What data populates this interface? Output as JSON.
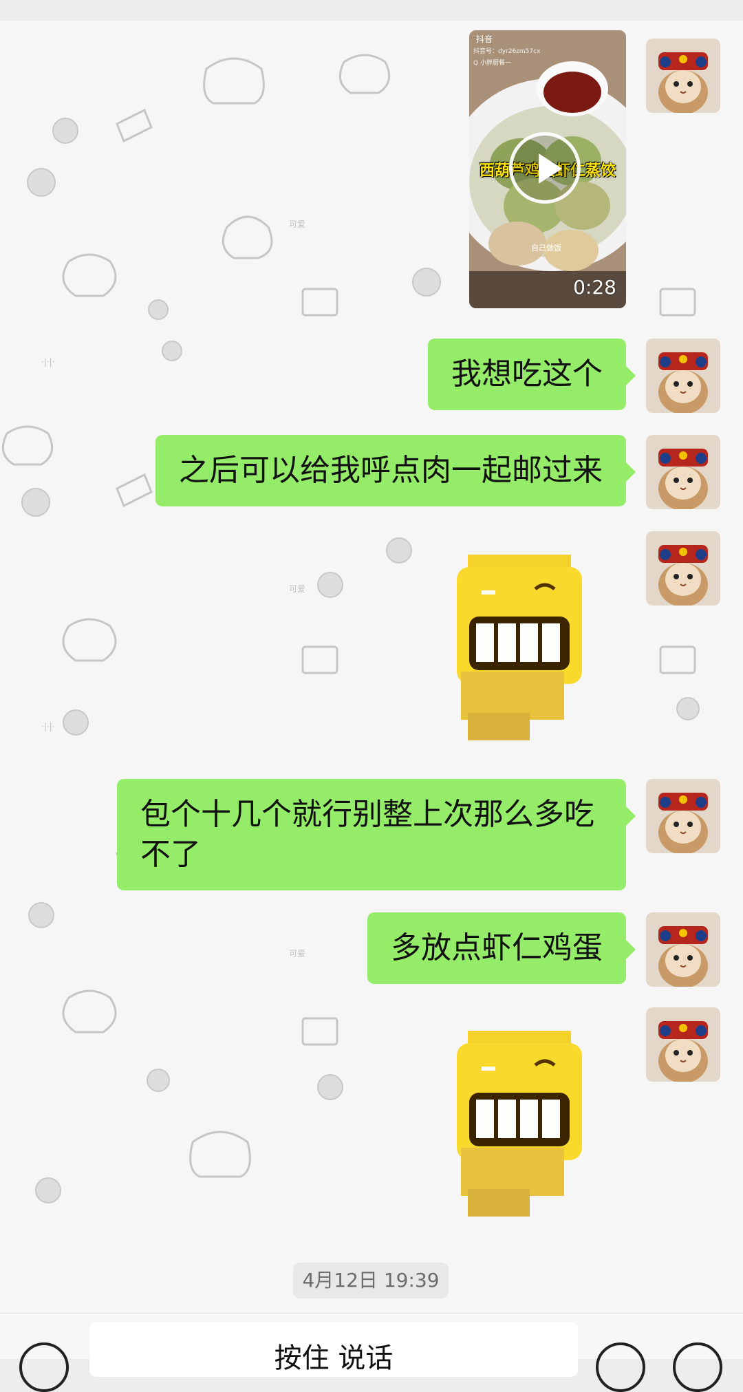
{
  "messages": [
    {
      "type": "video",
      "sender": "me",
      "source": "抖音",
      "account": "抖音号：dyr26zm57cx",
      "search": "Q 小胖厨餐一",
      "caption": "西葫芦鸡蛋虾仁蒸饺",
      "subcaption": "自己做饭",
      "duration": "0:28"
    },
    {
      "type": "text",
      "sender": "me",
      "text": "我想吃这个"
    },
    {
      "type": "text",
      "sender": "me",
      "text": "之后可以给我呼点肉一起邮过来"
    },
    {
      "type": "sticker",
      "sender": "me",
      "icon": "grinning-yellow-emoji-sticker"
    },
    {
      "type": "text",
      "sender": "me",
      "text": "包个十几个就行别整上次那么多吃\n不了"
    },
    {
      "type": "text",
      "sender": "me",
      "text": "多放点虾仁鸡蛋"
    },
    {
      "type": "sticker",
      "sender": "me",
      "icon": "grinning-yellow-emoji-sticker"
    }
  ],
  "timestamp": "4月12日 19:39",
  "input": {
    "hold_to_talk": "按住 说话",
    "voice_icon": "voice-icon",
    "emoji_icon": "emoji-icon",
    "more_icon": "plus-icon"
  },
  "colors": {
    "bubble": "#95ec69",
    "background": "#f6f6f6",
    "timestamp_bg": "#e6e6e6"
  }
}
